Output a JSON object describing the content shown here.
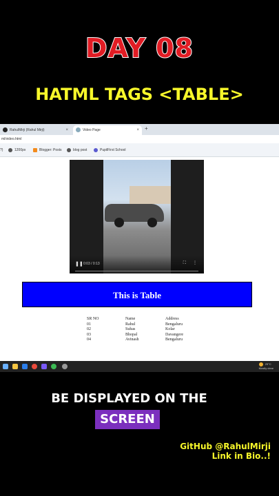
{
  "overlay": {
    "day_title": "DAY 08",
    "subtitle": "HATML TAGS <TABLE>",
    "caption_line1": "BE DISPLAYED ON THE",
    "caption_highlight": "SCREEN",
    "github": "GitHub @RahulMirji",
    "link": "Link in Bio..!"
  },
  "browser": {
    "tabs": [
      {
        "label": "RahulMirji (Rahul Mirji)",
        "icon": "github-icon"
      },
      {
        "label": "Video Page",
        "icon": "globe-icon"
      }
    ],
    "new_tab": "+",
    "close": "×",
    "address": "ml/video.html",
    "bookmarks": [
      "?)",
      "1200px",
      "Blogger: Posts",
      "blog post",
      "PupilFirst School"
    ]
  },
  "video": {
    "time": "0:03 / 0:13",
    "play_icon": "pause-icon"
  },
  "page": {
    "banner": "This is Table",
    "table": {
      "headers": [
        "SR NO",
        "Name",
        "Address"
      ],
      "rows": [
        [
          "01",
          "Rahul",
          "Bengaluru"
        ],
        [
          "02",
          "Suhas",
          "Kolar"
        ],
        [
          "03",
          "Bhopal",
          "Davangere"
        ],
        [
          "04",
          "Avinash",
          "Bengaluru"
        ]
      ]
    }
  },
  "taskbar": {
    "weather_temp": "29°C",
    "weather_desc": "Mostly clear"
  },
  "colors": {
    "banner": "#0000ff",
    "day_title": "#e11c24",
    "subtitle": "#f7f72a",
    "screen_highlight": "#7b2fbe"
  }
}
